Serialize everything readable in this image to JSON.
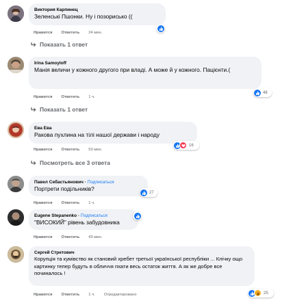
{
  "actions": {
    "like": "Нравится",
    "reply": "Ответить",
    "edited": "Отредактировано"
  },
  "comments": [
    {
      "author": "Виктория Карпинец",
      "follow": "",
      "text": "Зеленські Пшонки. Ну і позорисько ((",
      "time": "24 мин.",
      "reactions": "",
      "replies": "Показать 1 ответ"
    },
    {
      "author": "Irina Samoyloff",
      "follow": "",
      "text": "Манія величи у кожного другого при владі. А може й у кожного. Пацієнти.(",
      "time": "1 ч.",
      "reactions": "48",
      "replies": "Показать 1 ответ"
    },
    {
      "author": "Ева Ева",
      "follow": "",
      "text": "Ракова пухлина на тілі нашої держави і народу",
      "time": "53 мин.",
      "reactions": "16",
      "replies": "Посмотреть все 3 ответа"
    },
    {
      "author": "Павел Себастьянович",
      "follow": "Подписаться",
      "text": "Портрети подільників?",
      "time": "1 ч.",
      "reactions": "27",
      "replies": ""
    },
    {
      "author": "Eugene Stepanenko",
      "follow": "Подписаться",
      "text": "\"ВИСОКИЙ\" рівень забудовника",
      "time": "43 мин.",
      "reactions": "",
      "replies": ""
    },
    {
      "author": "Сергей Стретович",
      "follow": "",
      "text": "Корупція та кумівство як становий хребет третьої української республіки ... Клічку ощо картинку тепер будуть в обличчя пхати весь остаток життя. А як же добре все починалось !",
      "time": "1 ч.",
      "reactions": "25",
      "replies": ""
    }
  ],
  "colors": {
    "bubble": "#f0f2f5",
    "like": "#1877f2",
    "heart": "#f33e58",
    "haha": "#f7b125",
    "meta": "#65676b"
  }
}
